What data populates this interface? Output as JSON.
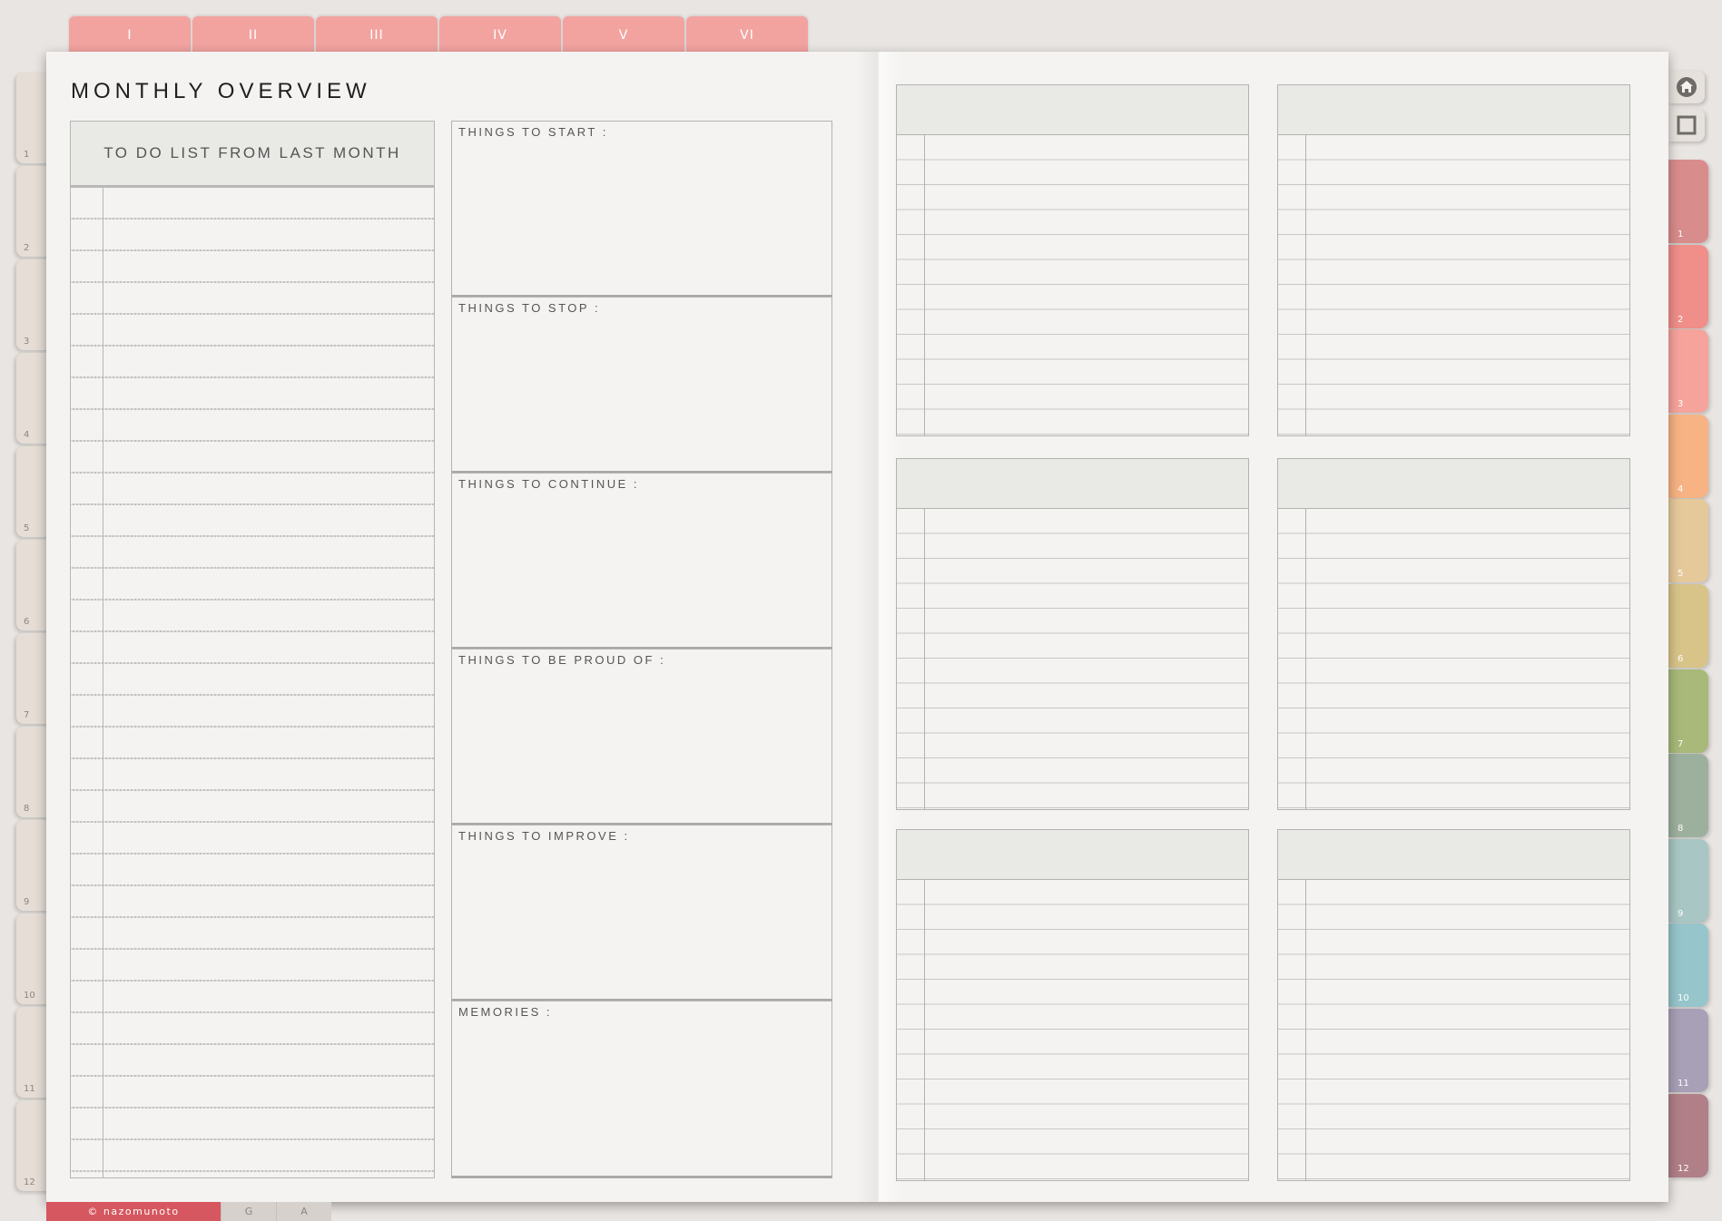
{
  "top_tabs": [
    "I",
    "II",
    "III",
    "IV",
    "V",
    "VI"
  ],
  "left_tabs": [
    "1",
    "2",
    "3",
    "4",
    "5",
    "6",
    "7",
    "8",
    "9",
    "10",
    "11",
    "12"
  ],
  "right_tabs": [
    {
      "label": "1",
      "color": "#d98c8c"
    },
    {
      "label": "2",
      "color": "#f08e8a"
    },
    {
      "label": "3",
      "color": "#f6a39c"
    },
    {
      "label": "4",
      "color": "#f7b383"
    },
    {
      "label": "5",
      "color": "#e5c99a"
    },
    {
      "label": "6",
      "color": "#d8c488"
    },
    {
      "label": "7",
      "color": "#a8b979"
    },
    {
      "label": "8",
      "color": "#9db09e"
    },
    {
      "label": "9",
      "color": "#a8c6c3"
    },
    {
      "label": "10",
      "color": "#96c5cb"
    },
    {
      "label": "11",
      "color": "#a8a0b6"
    },
    {
      "label": "12",
      "color": "#b07f88"
    }
  ],
  "nav_icons": [
    "home-icon",
    "square-icon"
  ],
  "title": "MONTHLY OVERVIEW",
  "todo": {
    "heading": "TO DO LIST FROM LAST MONTH"
  },
  "reflect": [
    "THINGS TO START :",
    "THINGS TO STOP :",
    "THINGS TO CONTINUE :",
    "THINGS TO BE PROUD OF :",
    "THINGS TO IMPROVE :",
    "MEMORIES :"
  ],
  "footer": {
    "copyright": "© nazomunoto",
    "tab_g": "G",
    "tab_a": "A"
  }
}
